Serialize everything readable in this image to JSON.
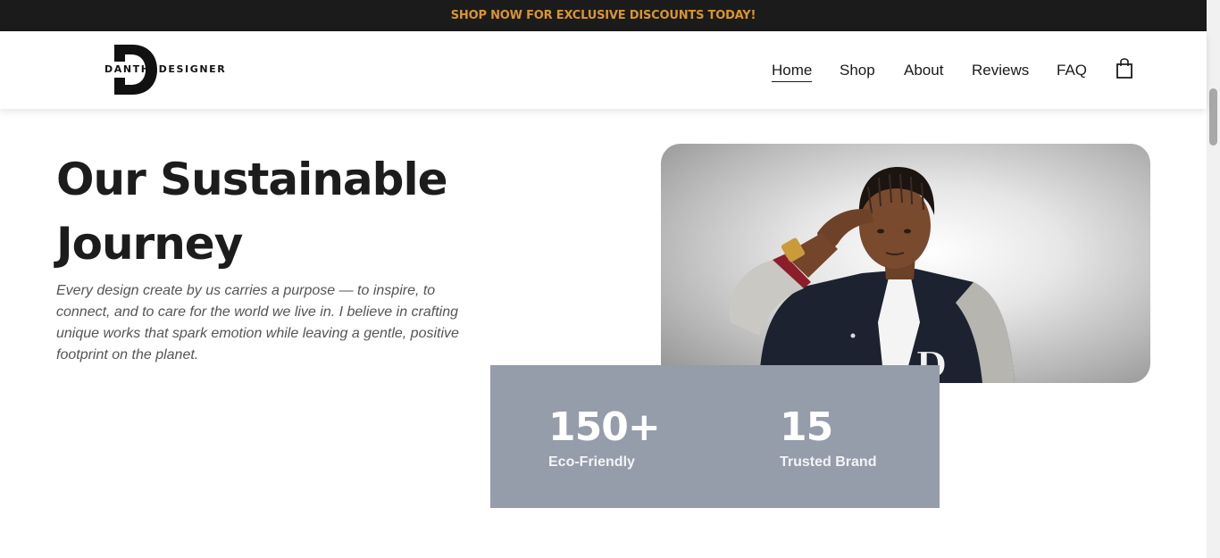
{
  "announcement": {
    "text": "SHOP NOW FOR EXCLUSIVE DISCOUNTS TODAY!",
    "color": "#d89530"
  },
  "brand": {
    "name": "DANTHEDESIGNER",
    "monogram": "D"
  },
  "nav": {
    "items": [
      {
        "label": "Home",
        "active": true
      },
      {
        "label": "Shop",
        "active": false
      },
      {
        "label": "About",
        "active": false
      },
      {
        "label": "Reviews",
        "active": false
      },
      {
        "label": "FAQ",
        "active": false
      }
    ],
    "cart_icon": "shopping-bag-icon"
  },
  "hero": {
    "title_line1": "Our Sustainable",
    "title_line2": "Journey",
    "description": "Every design create by us carries a purpose — to inspire, to connect, and to care for the world we live in. I believe in crafting unique works that spark emotion while leaving a gentle, positive footprint on the planet."
  },
  "stats": [
    {
      "value": "150+",
      "label": "Eco-Friendly"
    },
    {
      "value": "15",
      "label": "Trusted Brand"
    }
  ],
  "colors": {
    "stats_bg": "#959caa",
    "topbar_bg": "#1b1b1b",
    "accent": "#d89530"
  }
}
